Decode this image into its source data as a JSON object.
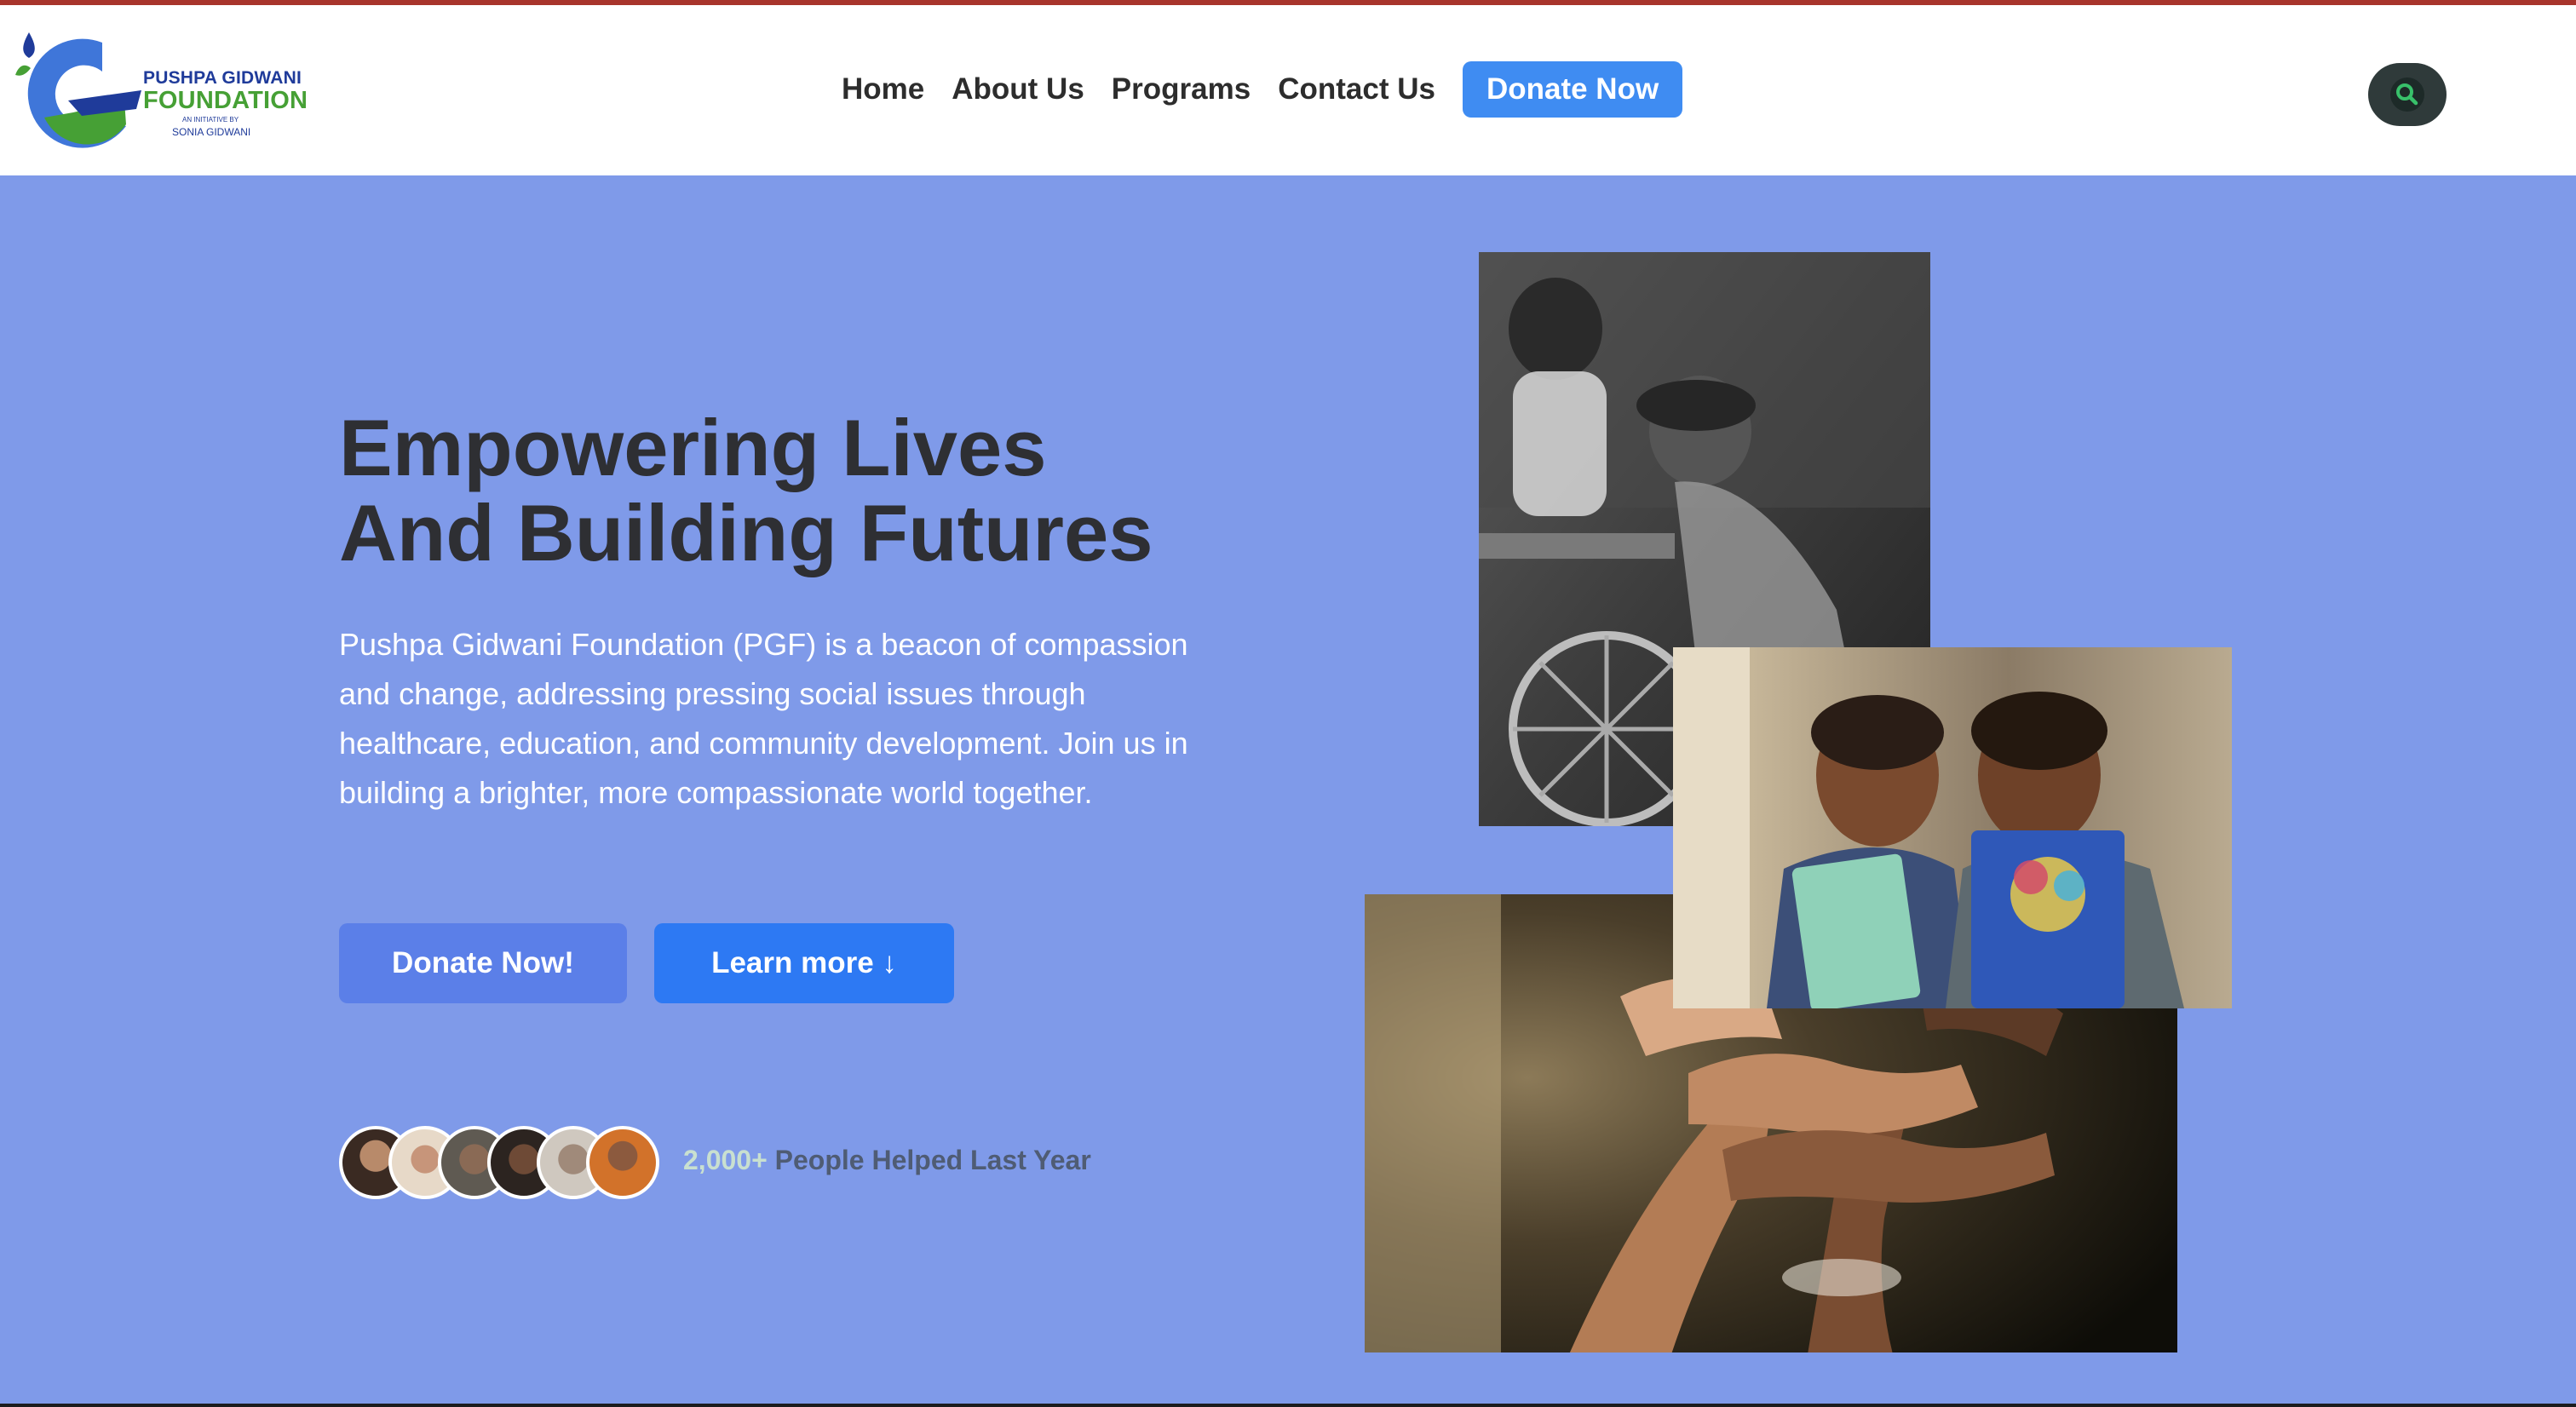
{
  "brand": {
    "line1": "PUSHPA GIDWANI",
    "line2": "FOUNDATION",
    "line3": "AN INITIATIVE BY",
    "line4": "SONIA GIDWANI"
  },
  "nav": {
    "items": [
      {
        "label": "Home"
      },
      {
        "label": "About Us"
      },
      {
        "label": "Programs"
      },
      {
        "label": "Contact Us"
      }
    ],
    "donate_label": "Donate Now",
    "search_icon": "search-icon"
  },
  "hero": {
    "title_line1": "Empowering Lives",
    "title_line2": "And Building Futures",
    "description": "Pushpa Gidwani Foundation (PGF) is a beacon of compassion and change, addressing pressing social issues through healthcare, education, and community development. Join us in building a brighter, more compassionate world together.",
    "donate_button": "Donate Now!",
    "learn_button": "Learn more ↓",
    "helped_count": "2,000+",
    "helped_text": "People Helped Last Year"
  },
  "colors": {
    "hero_bg": "#7f9ae9",
    "accent": "#3f8cf2",
    "heading": "#2e2f33",
    "brand_blue": "#1f3b9a",
    "brand_green": "#46a035"
  }
}
